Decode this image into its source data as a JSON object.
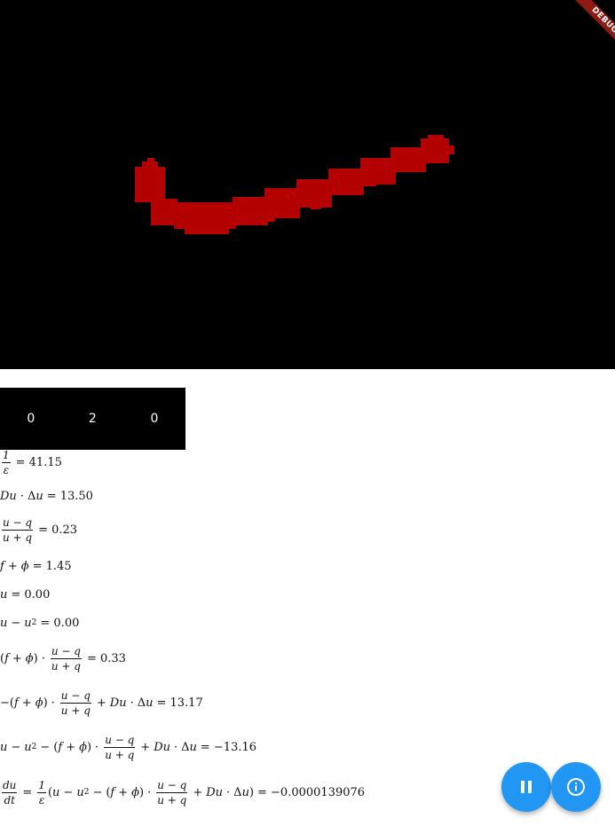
{
  "debug_banner": {
    "label": "DEBUG"
  },
  "counters": [
    "0",
    "2",
    "0"
  ],
  "formulas": {
    "inv_epsilon": "= 41.15",
    "diffusion": "= 13.50",
    "ratio": "= 0.23",
    "f_plus_phi": "= 1.45",
    "u": "= 0.00",
    "u_minus_u2": "= 0.00",
    "product": "= 0.33",
    "neg_product_plus_diff": "= 13.17",
    "full_rhs": "= −13.16",
    "dudt": "= −0.0000139076"
  },
  "buttons": {
    "pause_icon": "pause-icon",
    "info_icon": "info-icon"
  },
  "colors": {
    "fab": "#2196f3",
    "pattern": "#b30000",
    "canvas": "#000000",
    "debug_ribbon": "#8b1b14"
  }
}
